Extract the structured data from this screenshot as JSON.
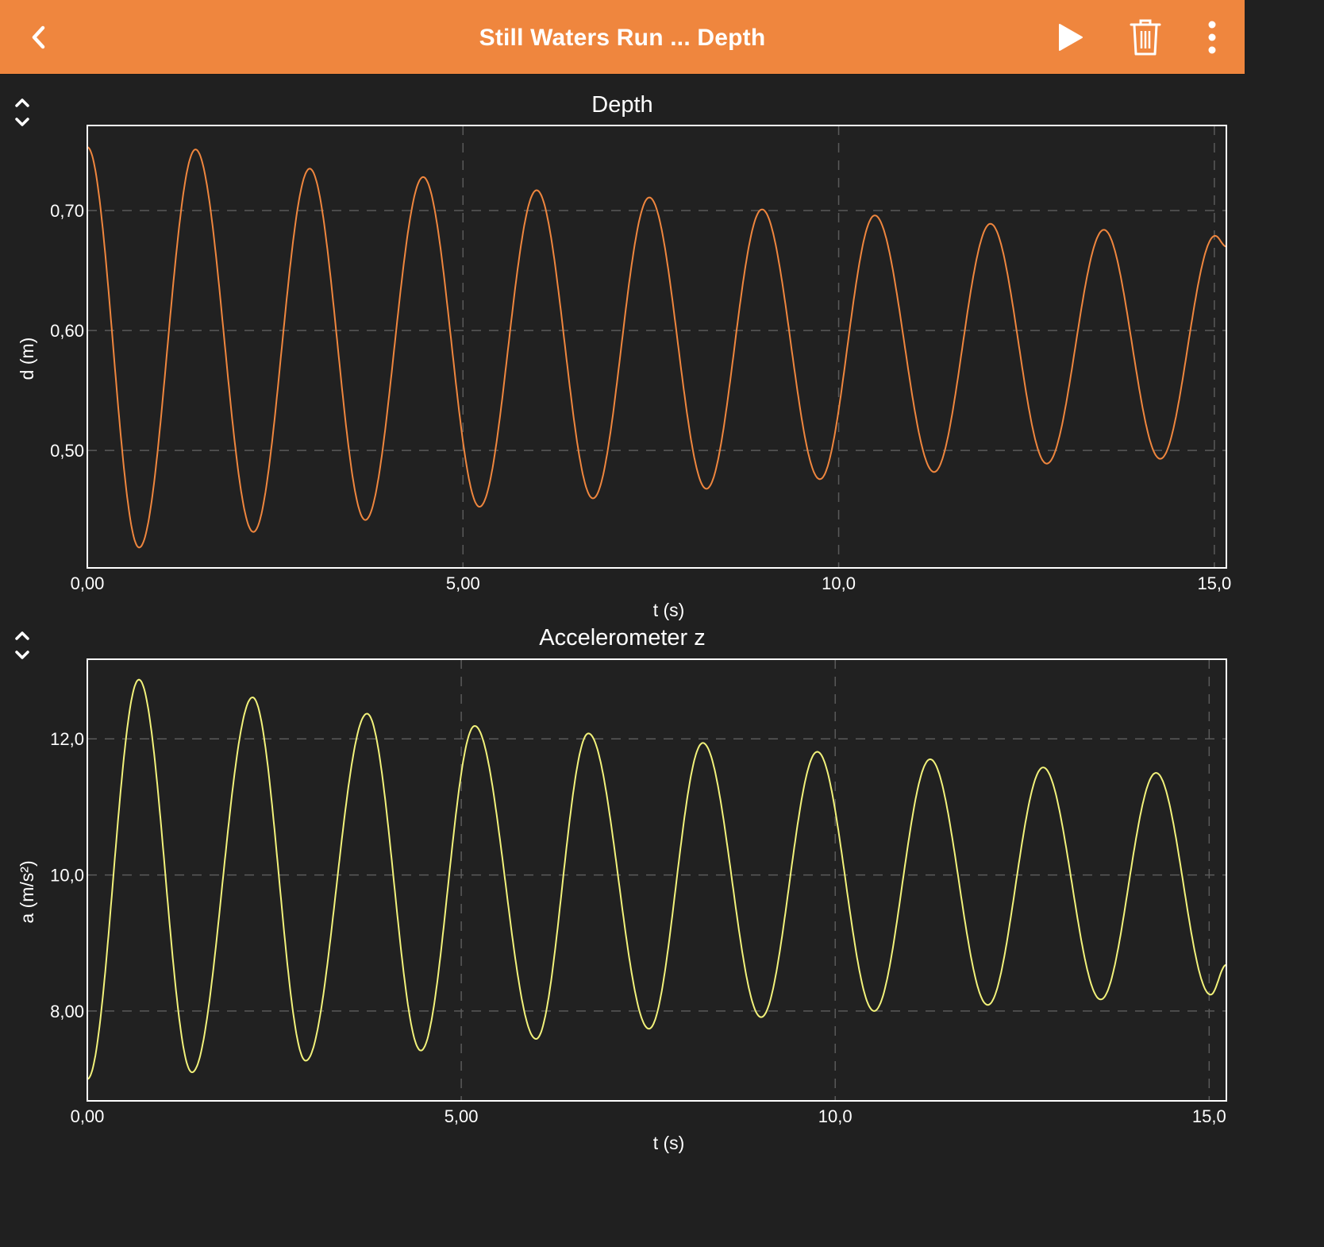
{
  "app_bar": {
    "title": "Still Waters Run ... Depth",
    "background_color": "#ef863e",
    "icons": {
      "back": "chevron-left-icon",
      "play": "play-icon",
      "delete": "trash-icon",
      "more": "more-vertical-icon"
    }
  },
  "panels": [
    {
      "title": "Depth",
      "toggle_icon": "expand-collapse-icon"
    },
    {
      "title": "Accelerometer z",
      "toggle_icon": "expand-collapse-icon"
    }
  ],
  "chart_data": [
    {
      "type": "line",
      "title": "Depth",
      "xlabel": "t (s)",
      "ylabel": "d (m)",
      "xlim": [
        0,
        15.16
      ],
      "ylim": [
        0.402,
        0.771
      ],
      "xticks": [
        0,
        5,
        10,
        15
      ],
      "xtick_labels": [
        "0,00",
        "5,00",
        "10,0",
        "15,0"
      ],
      "yticks": [
        0.5,
        0.6,
        0.7
      ],
      "ytick_labels": [
        "0,50",
        "0,60",
        "0,70"
      ],
      "grid": true,
      "line_color": "#ef863e",
      "series": [
        {
          "name": "Depth",
          "extrema": [
            [
              0.0,
              0.753
            ],
            [
              0.69,
              0.419
            ],
            [
              1.44,
              0.751
            ],
            [
              2.21,
              0.432
            ],
            [
              2.96,
              0.735
            ],
            [
              3.7,
              0.442
            ],
            [
              4.47,
              0.728
            ],
            [
              5.22,
              0.453
            ],
            [
              5.98,
              0.717
            ],
            [
              6.73,
              0.46
            ],
            [
              7.48,
              0.711
            ],
            [
              8.24,
              0.468
            ],
            [
              8.98,
              0.701
            ],
            [
              9.75,
              0.476
            ],
            [
              10.48,
              0.696
            ],
            [
              11.27,
              0.482
            ],
            [
              12.02,
              0.689
            ],
            [
              12.77,
              0.489
            ],
            [
              13.53,
              0.684
            ],
            [
              14.28,
              0.493
            ],
            [
              15.01,
              0.679
            ],
            [
              15.16,
              0.67
            ]
          ]
        }
      ]
    },
    {
      "type": "line",
      "title": "Accelerometer z",
      "xlabel": "t (s)",
      "ylabel": "a (m/s²)",
      "xlim": [
        0,
        15.23
      ],
      "ylim": [
        6.68,
        13.17
      ],
      "xticks": [
        0,
        5,
        10,
        15
      ],
      "xtick_labels": [
        "0,00",
        "5,00",
        "10,0",
        "15,0"
      ],
      "yticks": [
        8,
        10,
        12
      ],
      "ytick_labels": [
        "8,00",
        "10,0",
        "12,0"
      ],
      "grid": true,
      "line_color": "#f2f27a",
      "series": [
        {
          "name": "Accelerometer z",
          "extrema": [
            [
              0.0,
              7.0
            ],
            [
              0.69,
              12.87
            ],
            [
              1.4,
              7.1
            ],
            [
              2.21,
              12.61
            ],
            [
              2.92,
              7.27
            ],
            [
              3.74,
              12.37
            ],
            [
              4.46,
              7.42
            ],
            [
              5.18,
              12.19
            ],
            [
              6.0,
              7.59
            ],
            [
              6.7,
              12.08
            ],
            [
              7.51,
              7.74
            ],
            [
              8.23,
              11.94
            ],
            [
              9.01,
              7.91
            ],
            [
              9.76,
              11.81
            ],
            [
              10.52,
              8.0
            ],
            [
              11.27,
              11.7
            ],
            [
              12.04,
              8.09
            ],
            [
              12.78,
              11.58
            ],
            [
              13.55,
              8.17
            ],
            [
              14.29,
              11.5
            ],
            [
              15.02,
              8.24
            ],
            [
              15.23,
              8.68
            ]
          ]
        }
      ]
    }
  ]
}
